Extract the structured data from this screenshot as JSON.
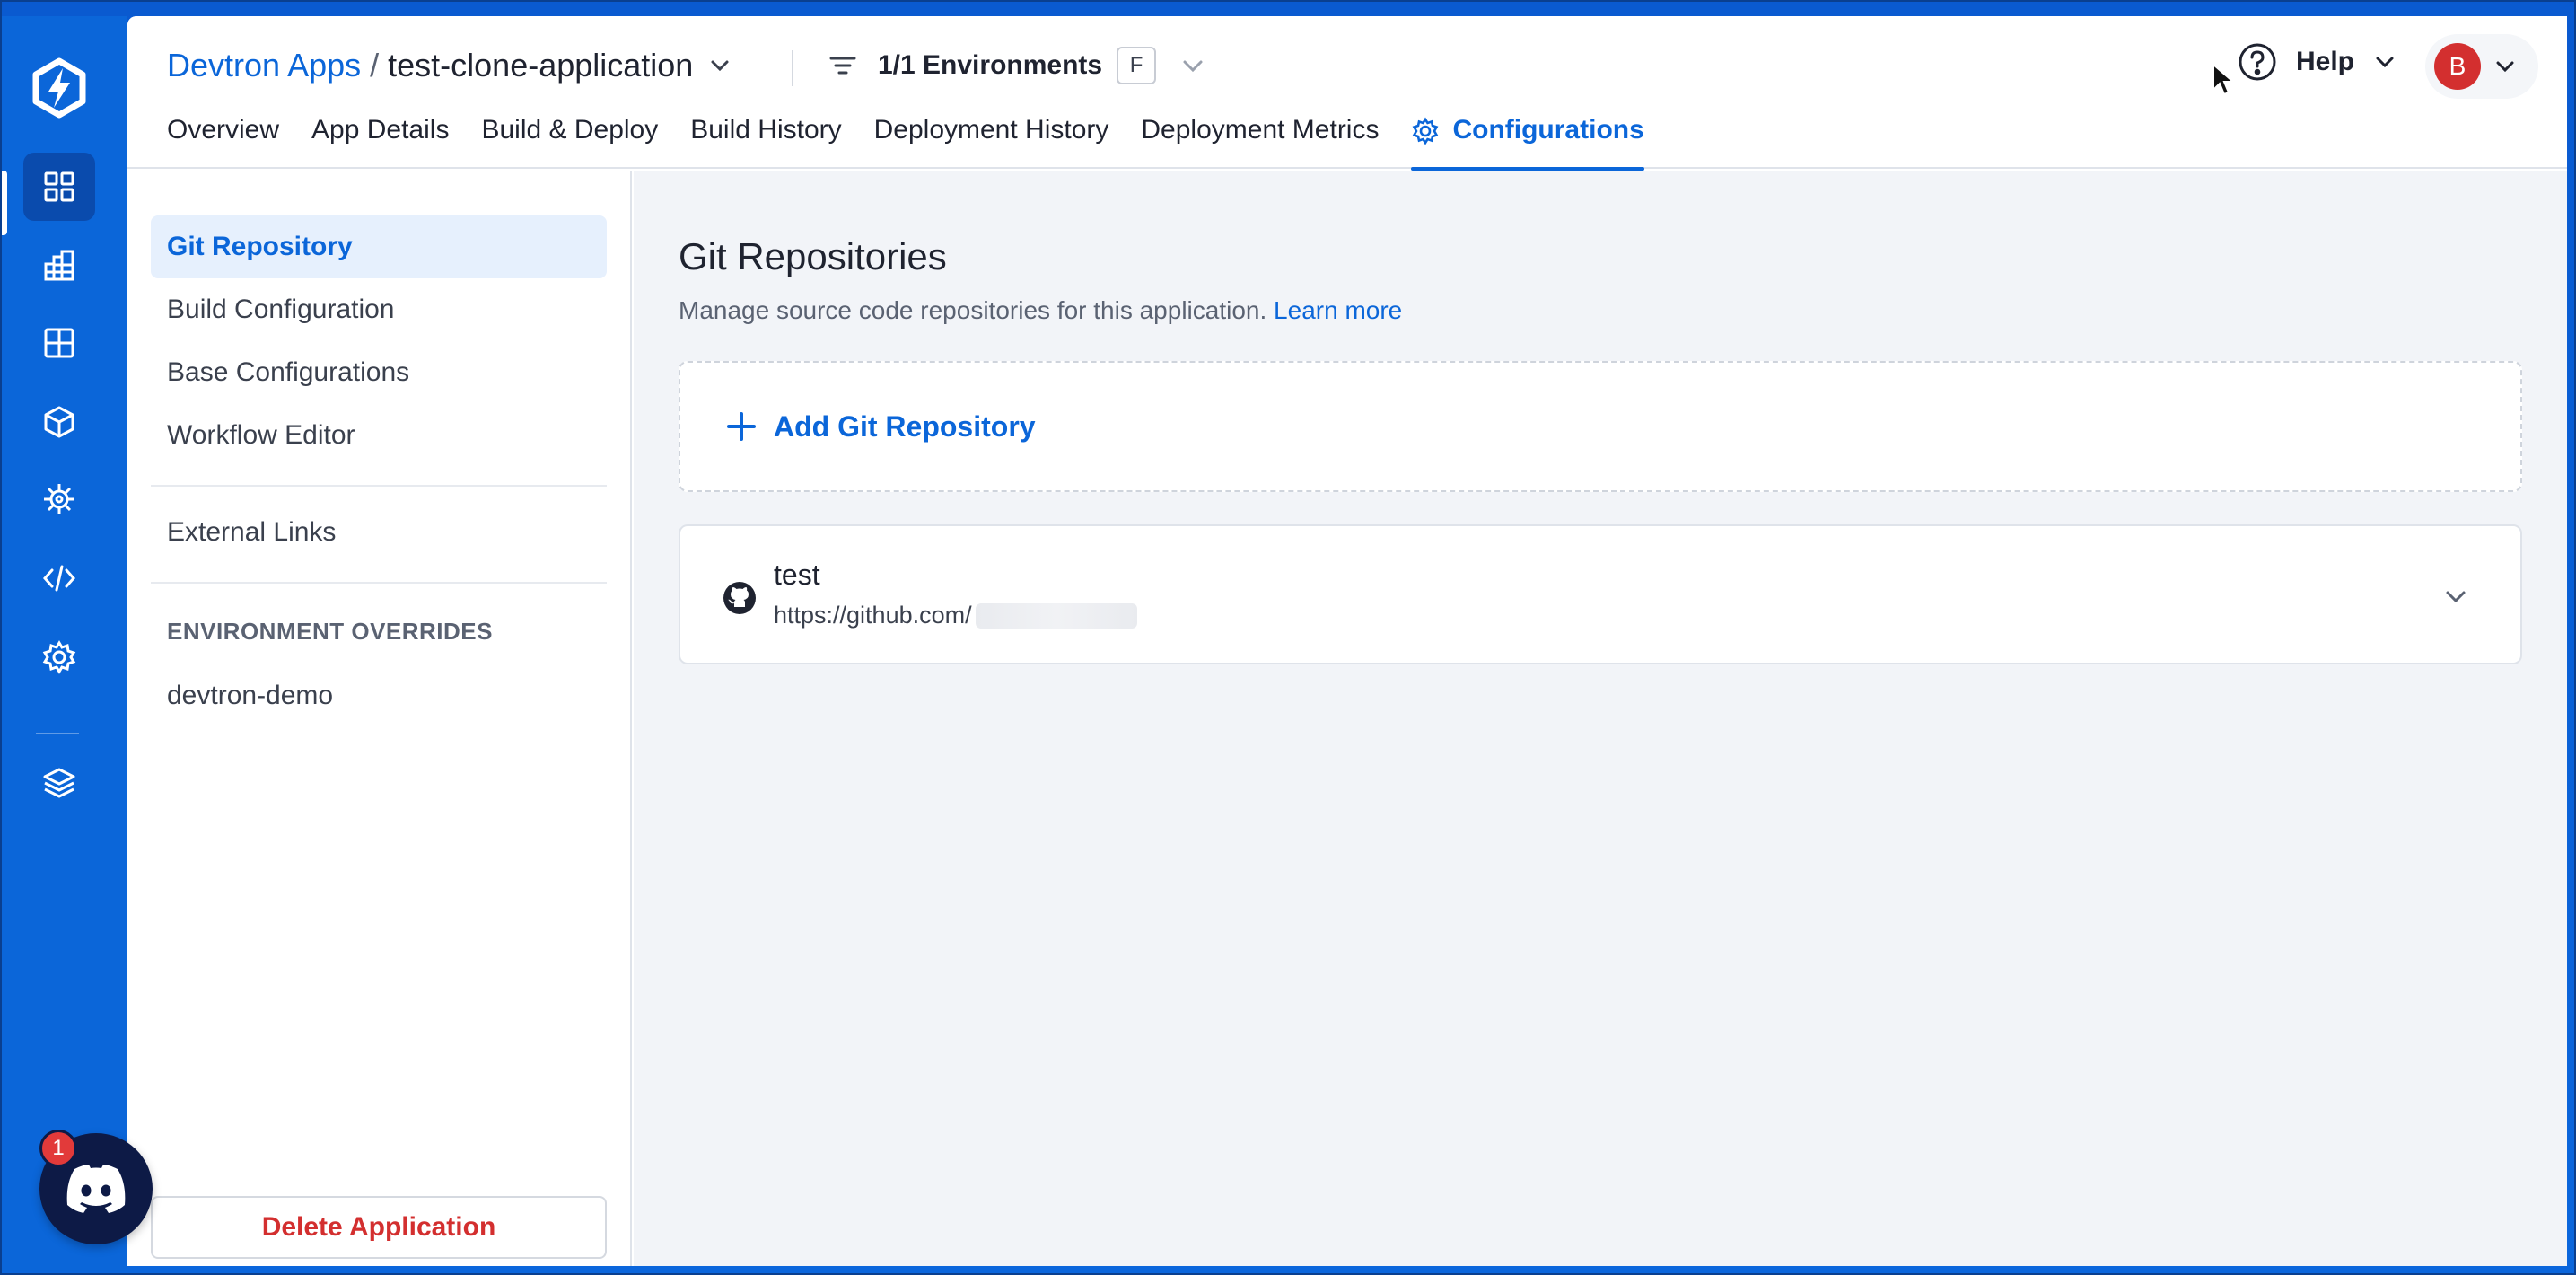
{
  "header": {
    "breadcrumb_root": "Devtron Apps",
    "breadcrumb_sep": "/",
    "app_name": "test-clone-application",
    "env_filter_label": "1/1 Environments",
    "env_badge": "F",
    "help_label": "Help",
    "avatar_initial": "B"
  },
  "tabs": [
    {
      "label": "Overview"
    },
    {
      "label": "App Details"
    },
    {
      "label": "Build & Deploy"
    },
    {
      "label": "Build History"
    },
    {
      "label": "Deployment History"
    },
    {
      "label": "Deployment Metrics"
    },
    {
      "label": "Configurations",
      "active": true
    }
  ],
  "sidemenu": {
    "items": [
      {
        "label": "Git Repository",
        "active": true
      },
      {
        "label": "Build Configuration"
      },
      {
        "label": "Base Configurations"
      },
      {
        "label": "Workflow Editor"
      }
    ],
    "external_links": "External Links",
    "env_overrides_heading": "ENVIRONMENT OVERRIDES",
    "env_overrides": [
      {
        "label": "devtron-demo"
      }
    ],
    "delete_label": "Delete Application"
  },
  "content": {
    "title": "Git Repositories",
    "description": "Manage source code repositories for this application.",
    "learn_more": "Learn more",
    "add_repo_label": "Add Git Repository",
    "repos": [
      {
        "name": "test",
        "url": "https://github.com/"
      }
    ]
  },
  "rail": {
    "icons": [
      "apps-grid-icon",
      "chart-store-icon",
      "resource-grid-icon",
      "package-icon",
      "security-icon",
      "code-icon",
      "settings-icon",
      "stack-icon"
    ],
    "discord_badge": "1"
  },
  "colors": {
    "accent": "#0b66d9",
    "rail_bg": "#0b66d9",
    "danger": "#d32f2f"
  }
}
